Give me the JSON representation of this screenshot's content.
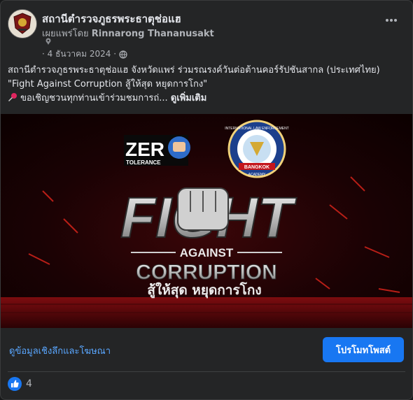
{
  "post": {
    "page_name": "สถานีตำรวจภูธรพระธาตุช่อแฮ",
    "shared_by_prefix": "เผยแพร่โดย",
    "shared_by_name": "Rinnarong Thananusakt",
    "date": "· 4 ธันวาคม 2024 ·",
    "text_line1": "สถานีตำรวจภูธรพระธาตุช่อแฮ จังหวัดแพร่ ร่วมรณรงค์วันต่อต้านคอร์รัปชันสากล (ประเทศไทย)",
    "text_line2": "\"Fight Against Corruption สู้ให้สุด หยุดการโกง\"",
    "text_line3": "ขอเชิญชวนทุกท่านเข้าร่วมชมการถ่...",
    "see_more": "ดูเพิ่มเติม"
  },
  "banner": {
    "zero_text": "ZER",
    "tolerance_text": "TOLERANCE",
    "seal_top": "INTERNATIONAL LAW ENFORCEMENT",
    "seal_bottom": "ACADEMY",
    "seal_ribbon": "BANGKOK",
    "fight_text": "FIGHT",
    "against_text": "AGAINST",
    "corruption_text": "CORRUPTION",
    "thai_slogan": "สู้ให้สุด หยุดการโกง"
  },
  "footer": {
    "insights_label": "ดูข้อมูลเชิงลึกและโฆษณา",
    "promote_label": "โปรโมทโพสต์"
  },
  "reactions": {
    "like_count": "4"
  },
  "colors": {
    "card_bg": "#242526",
    "link_blue": "#5aa7ff",
    "button_blue": "#1877f2",
    "banner_red": "#c4161c"
  }
}
